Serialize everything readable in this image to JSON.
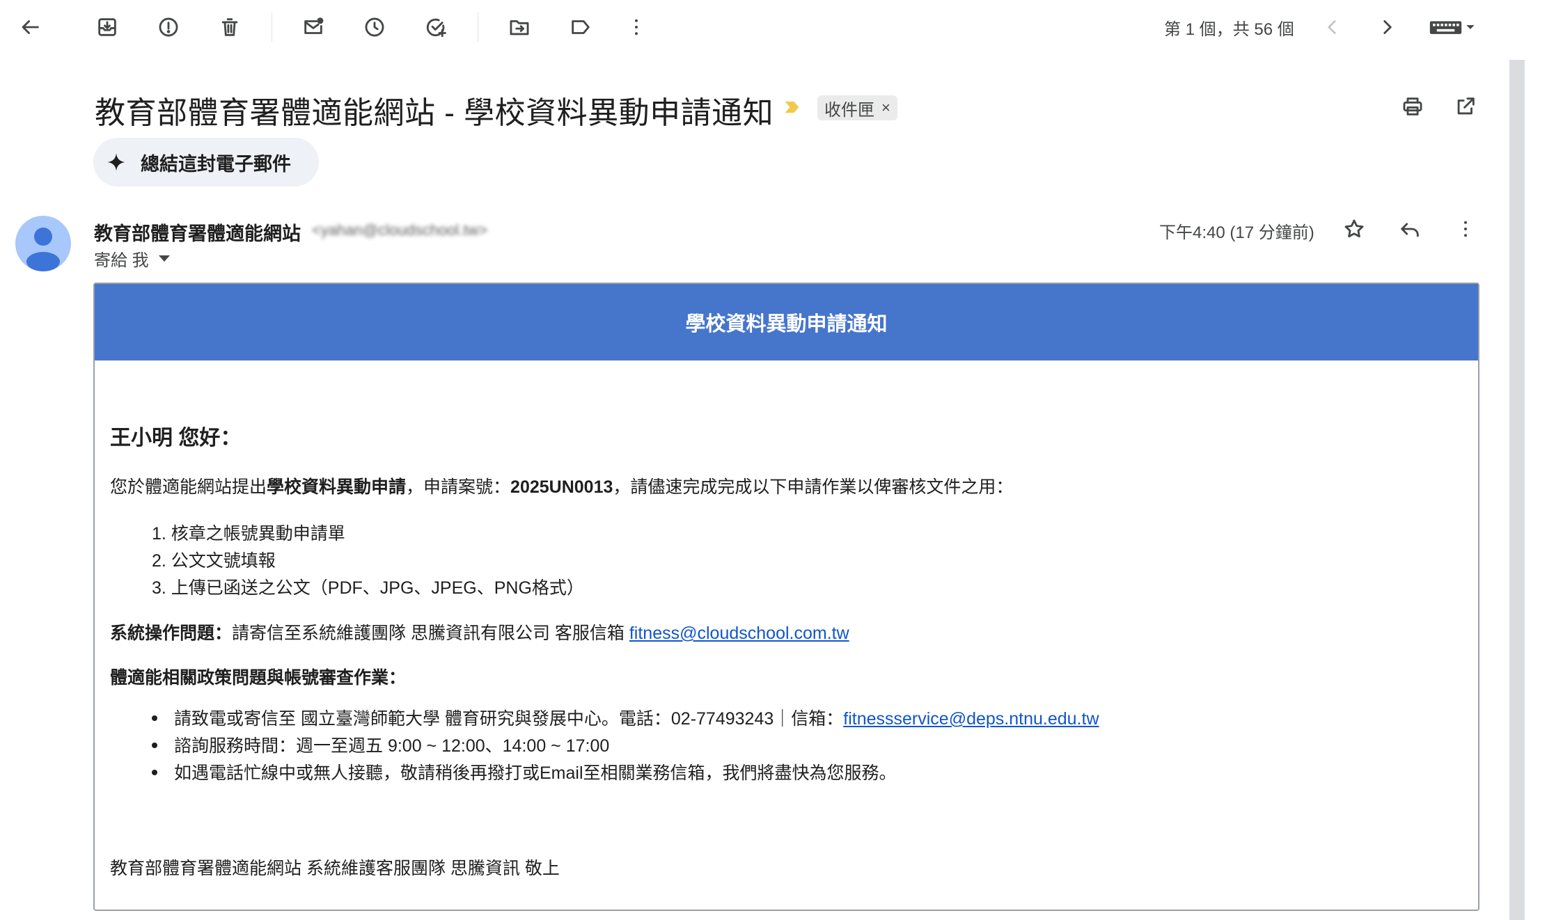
{
  "toolbar": {
    "pager_text": "第 1 個，共 56 個"
  },
  "subject": "教育部體育署體適能網站 - 學校資料異動申請通知",
  "label_chip": "收件匣",
  "label_remove": "×",
  "summarize_label": "總結這封電子郵件",
  "sender": {
    "name": "教育部體育署體適能網站",
    "email": "<yahan@cloudschool.tw>",
    "to": "寄給 我",
    "date": "下午4:40 (17 分鐘前)"
  },
  "email": {
    "banner": "學校資料異動申請通知",
    "greeting": "王小明 您好：",
    "intro": {
      "before": "您於體適能網站提出",
      "highlight1": "學校資料異動申請",
      "mid": "，申請案號：",
      "case_no": "2025UN0013",
      "after": "，請儘速完成完成以下申請作業以俾審核文件之用："
    },
    "steps": [
      "1. 核章之帳號異動申請單",
      "2. 公文文號填報",
      "3. 上傳已函送之公文（PDF、JPG、JPEG、PNG格式）"
    ],
    "op_issue": {
      "label": "系統操作問題：",
      "text": "請寄信至系統維護團隊 思騰資訊有限公司 客服信箱 ",
      "link": "fitness@cloudschool.com.tw"
    },
    "policy_heading": "體適能相關政策問題與帳號審查作業：",
    "policy_items": [
      {
        "text": "請致電或寄信至 國立臺灣師範大學 體育研究與發展中心。電話：02-77493243｜信箱：",
        "link": "fitnessservice@deps.ntnu.edu.tw"
      },
      {
        "text": "諮詢服務時間：週一至週五 9:00 ~ 12:00、14:00 ~ 17:00",
        "link": ""
      },
      {
        "text": "如遇電話忙線中或無人接聽，敬請稍後再撥打或Email至相關業務信箱，我們將盡快為您服務。",
        "link": ""
      }
    ],
    "signature": "教育部體育署體適能網站 系統維護客服團隊 思騰資訊 敬上"
  },
  "colors": {
    "banner": "#4675cc",
    "link": "#1155cc",
    "avatar": "#a8c7fa",
    "importance": "#f2c94c"
  }
}
